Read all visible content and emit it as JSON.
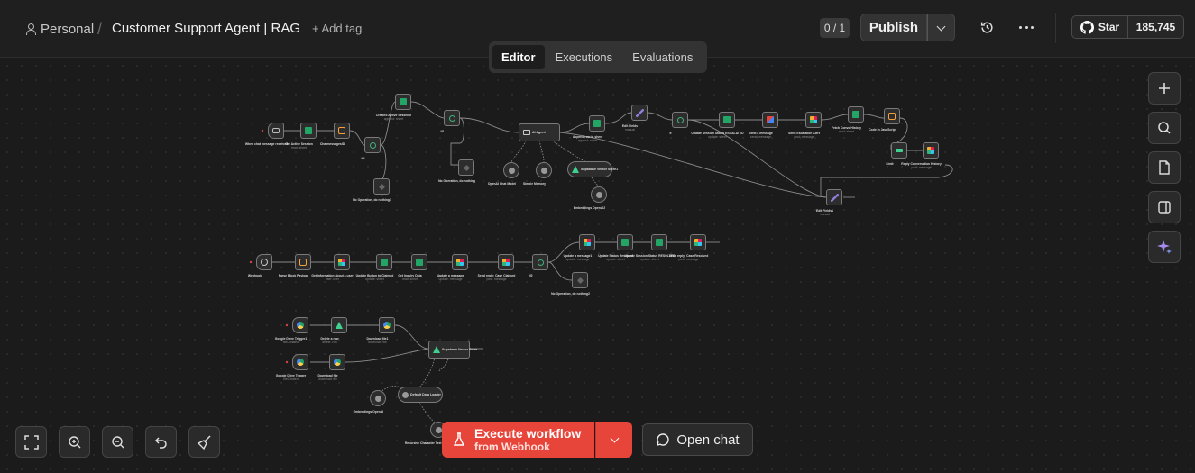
{
  "header": {
    "breadcrumb_personal": "Personal",
    "breadcrumb_separator": "/",
    "workflow_title": "Customer Support Agent | RAG",
    "add_tag": "+ Add tag",
    "version_badge": "0 / 1",
    "publish_label": "Publish",
    "github_star_label": "Star",
    "github_star_count": "185,745"
  },
  "tabs": [
    {
      "label": "Editor",
      "active": true
    },
    {
      "label": "Executions",
      "active": false
    },
    {
      "label": "Evaluations",
      "active": false
    }
  ],
  "nodes": [
    {
      "id": "n1",
      "label": "When chat message received",
      "sub": "",
      "icon": "chat-trigger-icon"
    },
    {
      "id": "n2",
      "label": "Get Active Session",
      "sub": "read: sheet",
      "icon": "google-sheets-icon"
    },
    {
      "id": "n3",
      "label": "ChatmessagesID",
      "sub": "",
      "icon": "code-icon"
    },
    {
      "id": "n4",
      "label": "If4",
      "sub": "",
      "icon": "if-icon"
    },
    {
      "id": "n5",
      "label": "Created Active Sesseion",
      "sub": "append: sheet",
      "icon": "google-sheets-icon"
    },
    {
      "id": "n6",
      "label": "No Operation, do nothing1",
      "sub": "",
      "icon": "no-op-icon"
    },
    {
      "id": "n7",
      "label": "If1",
      "sub": "",
      "icon": "if-icon"
    },
    {
      "id": "n8",
      "label": "No Operation, do nothing",
      "sub": "",
      "icon": "no-op-icon"
    },
    {
      "id": "n9",
      "label": "AI Agent",
      "sub": "",
      "icon": "ai-agent-icon"
    },
    {
      "id": "n10",
      "label": "OpenAI Chat Model",
      "sub": "",
      "icon": "openai-icon"
    },
    {
      "id": "n11",
      "label": "Simple Memory",
      "sub": "",
      "icon": "memory-icon"
    },
    {
      "id": "n12",
      "label": "Supabase Vector Store1",
      "sub": "",
      "icon": "supabase-icon"
    },
    {
      "id": "n13",
      "label": "Embeddings OpenAI2",
      "sub": "",
      "icon": "openai-icon"
    },
    {
      "id": "n14",
      "label": "Append row in sheet",
      "sub": "append: sheet",
      "icon": "google-sheets-icon"
    },
    {
      "id": "n15",
      "label": "Edit Fields",
      "sub": "manual",
      "icon": "edit-fields-icon"
    },
    {
      "id": "n16",
      "label": "If",
      "sub": "",
      "icon": "if-icon"
    },
    {
      "id": "n17",
      "label": "Update Session Status ESCALATED",
      "sub": "update: sheet",
      "icon": "google-sheets-icon"
    },
    {
      "id": "n18",
      "label": "Send a message",
      "sub": "send: message",
      "icon": "gmail-icon"
    },
    {
      "id": "n19",
      "label": "Send Escalation Alert",
      "sub": "post: message",
      "icon": "slack-icon"
    },
    {
      "id": "n20",
      "label": "Fetch Convo History",
      "sub": "read: sheet",
      "icon": "google-sheets-icon"
    },
    {
      "id": "n21",
      "label": "Code in JavaScript",
      "sub": "",
      "icon": "code-icon"
    },
    {
      "id": "n22",
      "label": "Limit",
      "sub": "",
      "icon": "limit-icon"
    },
    {
      "id": "n23",
      "label": "Reply Conversation History",
      "sub": "post: message",
      "icon": "slack-icon"
    },
    {
      "id": "n24",
      "label": "Edit Fields1",
      "sub": "manual",
      "icon": "edit-fields-icon"
    },
    {
      "id": "n25",
      "label": "Webhook",
      "sub": "",
      "icon": "webhook-icon"
    },
    {
      "id": "n26",
      "label": "Parse Block Payload",
      "sub": "",
      "icon": "code-icon"
    },
    {
      "id": "n27",
      "label": "Get information about a user",
      "sub": "user: user",
      "icon": "slack-icon"
    },
    {
      "id": "n28",
      "label": "Update Button to Claimed",
      "sub": "update: sheet",
      "icon": "google-sheets-icon"
    },
    {
      "id": "n29",
      "label": "Get Inquiry Data",
      "sub": "read: sheet",
      "icon": "google-sheets-icon"
    },
    {
      "id": "n30",
      "label": "Update a message",
      "sub": "update: message",
      "icon": "slack-icon"
    },
    {
      "id": "n31",
      "label": "Send reply: Case Claimed",
      "sub": "post: message",
      "icon": "slack-icon"
    },
    {
      "id": "n32",
      "label": "If2",
      "sub": "",
      "icon": "if-icon"
    },
    {
      "id": "n33",
      "label": "No Operation, do nothing2",
      "sub": "",
      "icon": "no-op-icon"
    },
    {
      "id": "n34",
      "label": "Update a message1",
      "sub": "update: message",
      "icon": "slack-icon"
    },
    {
      "id": "n35",
      "label": "Update Status Resolved",
      "sub": "update: sheet",
      "icon": "google-sheets-icon"
    },
    {
      "id": "n36",
      "label": "Update Session Status RESOLVED",
      "sub": "update: sheet",
      "icon": "google-sheets-icon"
    },
    {
      "id": "n37",
      "label": "Send reply: Case Resolved",
      "sub": "post: message",
      "icon": "slack-icon"
    },
    {
      "id": "n38",
      "label": "Google Drive Trigger1",
      "sub": "fileUpdated",
      "icon": "google-drive-icon"
    },
    {
      "id": "n39",
      "label": "Delete a row",
      "sub": "delete: row",
      "icon": "supabase-icon"
    },
    {
      "id": "n40",
      "label": "Download file1",
      "sub": "download: file",
      "icon": "google-drive-icon"
    },
    {
      "id": "n41",
      "label": "Google Drive Trigger",
      "sub": "fileCreated",
      "icon": "google-drive-icon"
    },
    {
      "id": "n42",
      "label": "Download file",
      "sub": "download: file",
      "icon": "google-drive-icon"
    },
    {
      "id": "n43",
      "label": "Supabase Vector Store",
      "sub": "",
      "icon": "supabase-icon"
    },
    {
      "id": "n44",
      "label": "Default Data Loader",
      "sub": "",
      "icon": "data-loader-icon"
    },
    {
      "id": "n45",
      "label": "Embeddings OpenAI",
      "sub": "",
      "icon": "openai-icon"
    },
    {
      "id": "n46",
      "label": "Recursive Character Text Splitter",
      "sub": "",
      "icon": "text-splitter-icon"
    }
  ],
  "footer": {
    "execute_main": "Execute workflow",
    "execute_sub": "from Webhook",
    "open_chat": "Open chat"
  },
  "colors": {
    "accent": "#e7443a",
    "canvas_bg": "#1b1b1b",
    "header_bg": "#1f1f1f"
  }
}
